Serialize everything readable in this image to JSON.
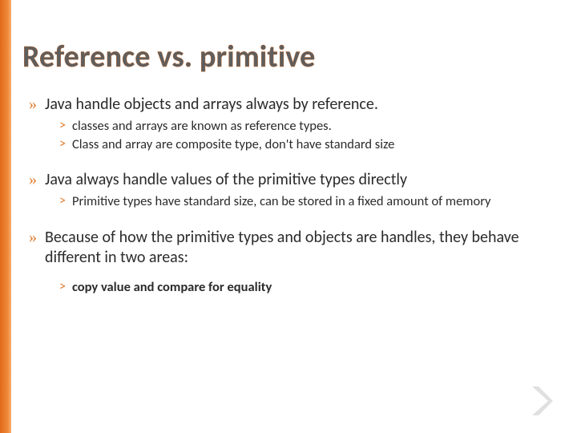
{
  "title": "Reference vs. primitive",
  "bullets": [
    {
      "text": "Java handle objects and arrays always by reference.",
      "sub": [
        {
          "text": "classes and arrays are known as reference types."
        },
        {
          "text": "Class and array are composite type, don't have standard size"
        }
      ]
    },
    {
      "text": "Java always handle values of the primitive types directly",
      "sub": [
        {
          "text": "Primitive types have standard size, can be stored in a fixed amount of memory"
        }
      ]
    },
    {
      "text": "Because of how the primitive types and objects are handles, they behave different in two areas:",
      "sub": [
        {
          "text": "copy value and compare for equality",
          "bold": true
        }
      ]
    }
  ],
  "glyphs": {
    "l1": "»",
    "l2": "˃"
  }
}
